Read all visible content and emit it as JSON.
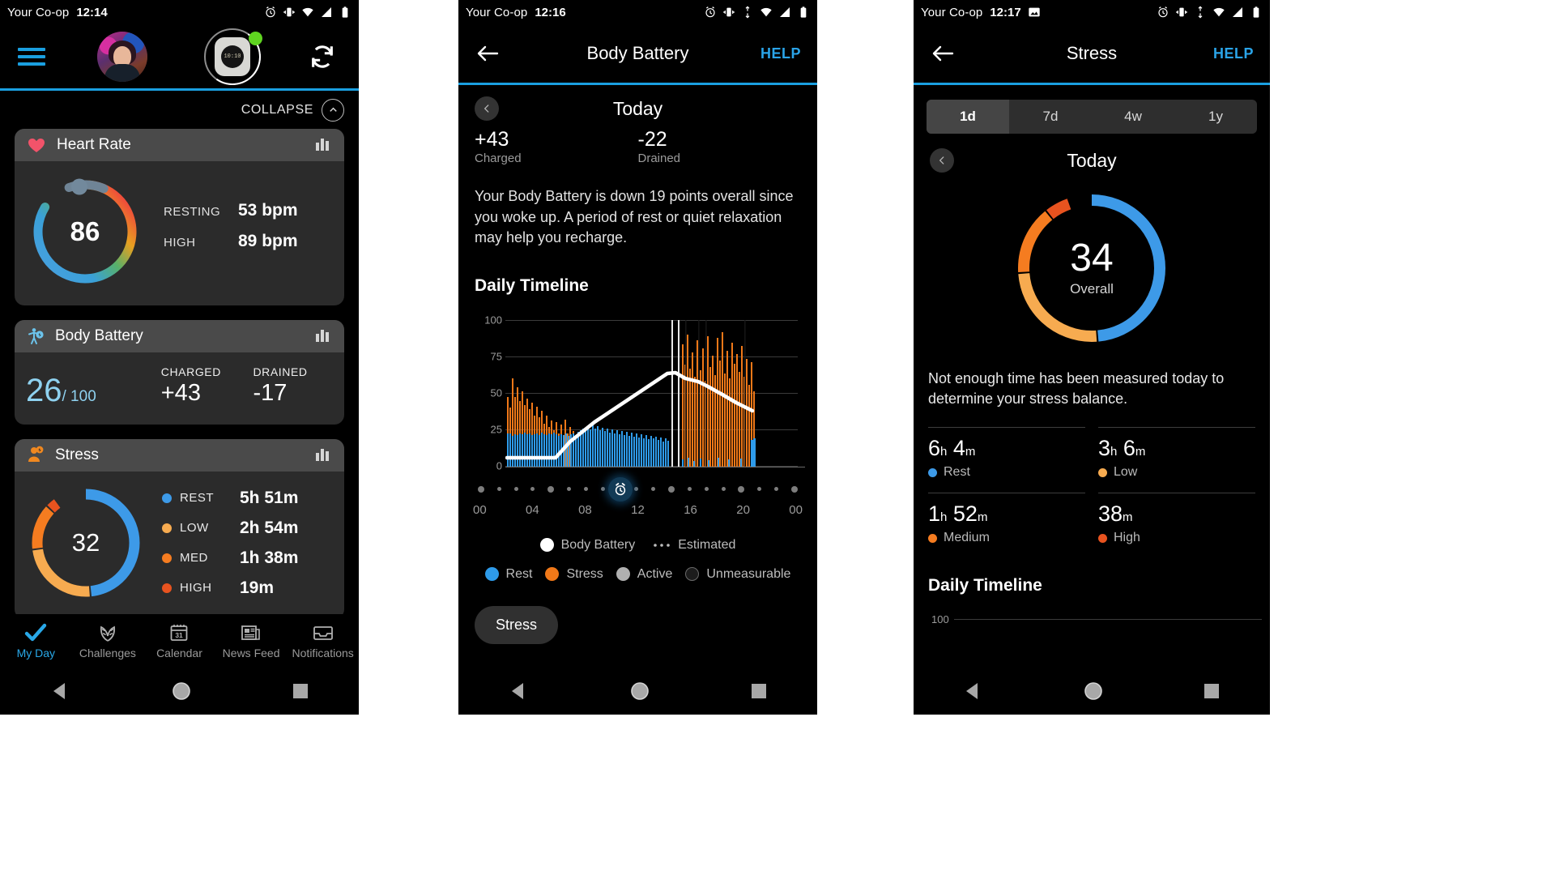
{
  "panel1": {
    "status": {
      "carrier": "Your Co-op",
      "time": "12:14",
      "icons": [
        "alarm-icon",
        "vibrate-icon",
        "wifi-icon",
        "signal-icon",
        "battery-icon"
      ]
    },
    "header": {
      "menu_icon": "hamburger-menu-icon",
      "avatar": "user-avatar",
      "device": "watch-device-icon",
      "device_time": "10:10",
      "sync_icon": "sync-refresh-icon",
      "status_dot_color": "#5fd420"
    },
    "collapse": {
      "label": "COLLAPSE",
      "icon": "chevron-up-icon"
    },
    "heart_rate": {
      "title": "Heart Rate",
      "icon": "heart-icon",
      "chart_icon": "bar-chart-icon",
      "current": "86",
      "rows": [
        {
          "label": "RESTING",
          "value": "53 bpm"
        },
        {
          "label": "HIGH",
          "value": "89 bpm"
        }
      ]
    },
    "body_battery": {
      "title": "Body Battery",
      "icon": "body-battery-icon",
      "chart_icon": "bar-chart-icon",
      "value": "26",
      "max": "/ 100",
      "charged_label": "CHARGED",
      "charged_value": "+43",
      "drained_label": "DRAINED",
      "drained_value": "-17"
    },
    "stress": {
      "title": "Stress",
      "icon": "stress-person-icon",
      "chart_icon": "bar-chart-icon",
      "score": "32",
      "legend": [
        {
          "label": "REST",
          "value": "5h 51m",
          "color": "#3d9ae8"
        },
        {
          "label": "LOW",
          "value": "2h 54m",
          "color": "#f7ab50"
        },
        {
          "label": "MED",
          "value": "1h 38m",
          "color": "#f57c20"
        },
        {
          "label": "HIGH",
          "value": "19m",
          "color": "#e8531f"
        }
      ]
    },
    "bottom_nav": [
      {
        "label": "My Day",
        "icon": "check-icon",
        "active": true
      },
      {
        "label": "Challenges",
        "icon": "laurel-wreath-icon",
        "active": false
      },
      {
        "label": "Calendar",
        "icon": "calendar-icon",
        "active": false
      },
      {
        "label": "News Feed",
        "icon": "newspaper-icon",
        "active": false
      },
      {
        "label": "Notifications",
        "icon": "inbox-icon",
        "active": false
      }
    ],
    "system_nav": [
      "back-triangle-icon",
      "home-circle-icon",
      "recents-square-icon"
    ]
  },
  "panel2": {
    "status": {
      "carrier": "Your Co-op",
      "time": "12:16"
    },
    "appbar": {
      "back_icon": "arrow-left-icon",
      "title": "Body Battery",
      "help": "HELP"
    },
    "daynav": {
      "prev_icon": "chevron-left-icon",
      "day": "Today"
    },
    "summary": {
      "charged_value": "+43",
      "charged_label": "Charged",
      "drained_value": "-22",
      "drained_label": "Drained"
    },
    "paragraph": "Your Body Battery is down 19 points overall since you woke up. A period of rest or quiet relaxation may help you recharge.",
    "section_title": "Daily Timeline",
    "chart_ylabels": [
      "100",
      "75",
      "50",
      "25",
      "0"
    ],
    "chart_xlabels": [
      "00",
      "04",
      "08",
      "12",
      "16",
      "20",
      "00"
    ],
    "alarm_icon": "alarm-clock-icon",
    "legend_top": [
      {
        "label": "Body Battery",
        "marker": "solid-white-dot",
        "color": "#ffffff"
      },
      {
        "label": "Estimated",
        "marker": "dotted-line",
        "color": "#bdbdbd"
      }
    ],
    "legend_bottom": [
      {
        "label": "Rest",
        "color": "#2e9bea"
      },
      {
        "label": "Stress",
        "color": "#f07818"
      },
      {
        "label": "Active",
        "color": "#b0b0b0"
      },
      {
        "label": "Unmeasurable",
        "color": "#2b2b2b"
      }
    ],
    "pill": "Stress"
  },
  "panel3": {
    "status": {
      "carrier": "Your Co-op",
      "time": "12:17"
    },
    "appbar": {
      "back_icon": "arrow-left-icon",
      "title": "Stress",
      "help": "HELP"
    },
    "range_tabs": [
      {
        "label": "1d",
        "active": true
      },
      {
        "label": "7d",
        "active": false
      },
      {
        "label": "4w",
        "active": false
      },
      {
        "label": "1y",
        "active": false
      }
    ],
    "daynav": {
      "prev_icon": "chevron-left-icon",
      "day": "Today"
    },
    "ring": {
      "score": "34",
      "sublabel": "Overall"
    },
    "message": "Not enough time has been measured today to determine your stress balance.",
    "stats": [
      {
        "hours": "6",
        "h": "h",
        "minutes": "4",
        "m": "m",
        "label": "Rest",
        "color": "#3d9ae8"
      },
      {
        "hours": "3",
        "h": "h",
        "minutes": "6",
        "m": "m",
        "label": "Low",
        "color": "#f7ab50"
      },
      {
        "hours": "1",
        "h": "h",
        "minutes": "52",
        "m": "m",
        "label": "Medium",
        "color": "#f57c20"
      },
      {
        "hours": "",
        "h": "",
        "minutes": "38",
        "m": "m",
        "label": "High",
        "color": "#e8531f"
      }
    ],
    "section_title": "Daily Timeline",
    "mini_axis": "100"
  },
  "chart_data": [
    {
      "type": "area",
      "title": "Daily Timeline",
      "panel": "Body Battery",
      "xlabel": "",
      "ylabel": "",
      "ylim": [
        0,
        100
      ],
      "yticks": [
        0,
        25,
        50,
        75,
        100
      ],
      "xticks": [
        "00",
        "04",
        "08",
        "12",
        "16",
        "20",
        "00"
      ],
      "grid": true,
      "legend": [
        "Body Battery",
        "Estimated",
        "Rest",
        "Stress",
        "Active",
        "Unmeasurable"
      ],
      "series": [
        {
          "name": "Body Battery",
          "x": [
            0,
            1,
            2,
            3,
            4,
            5,
            6,
            7,
            7.5,
            8,
            9,
            10,
            11,
            12
          ],
          "values": [
            7,
            7,
            7,
            7,
            14,
            22,
            31,
            40,
            48,
            47,
            41,
            36,
            31,
            26
          ]
        },
        {
          "name": "Stress (orange bars)",
          "x": [
            0,
            0.5,
            1,
            1.5,
            2,
            2.5,
            3,
            3.5,
            4,
            5,
            6,
            7,
            7.6,
            8,
            8.5,
            9,
            9.5,
            10,
            10.5,
            11,
            11.5,
            12
          ],
          "values": [
            30,
            48,
            40,
            35,
            32,
            25,
            5,
            0,
            0,
            0,
            0,
            0,
            75,
            70,
            72,
            78,
            68,
            80,
            70,
            74,
            66,
            40
          ]
        },
        {
          "name": "Rest (blue bars)",
          "x": [
            0,
            0.5,
            1,
            1.5,
            2,
            2.5,
            3,
            3.5,
            4,
            4.5,
            5,
            5.5,
            6,
            6.5,
            7,
            7.5,
            8,
            9,
            10,
            11,
            12
          ],
          "values": [
            22,
            20,
            20,
            21,
            22,
            24,
            23,
            24,
            23,
            22,
            21,
            22,
            23,
            22,
            22,
            20,
            8,
            6,
            5,
            5,
            25
          ]
        }
      ],
      "marker": {
        "label": "alarm",
        "x": 7.2
      }
    },
    {
      "type": "donut",
      "title": "Stress Today",
      "panel": "Stress",
      "center_value": 34,
      "center_label": "Overall",
      "slices": [
        {
          "name": "Rest",
          "value": 6.067,
          "label": "6 h 4 m",
          "color": "#3d9ae8"
        },
        {
          "name": "Low",
          "value": 3.1,
          "label": "3 h 6 m",
          "color": "#f7ab50"
        },
        {
          "name": "Medium",
          "value": 1.867,
          "label": "1 h 52 m",
          "color": "#f57c20"
        },
        {
          "name": "High",
          "value": 0.633,
          "label": "38 m",
          "color": "#e8531f"
        }
      ]
    },
    {
      "type": "donut",
      "title": "Stress (card)",
      "panel": "My Day",
      "center_value": 32,
      "slices": [
        {
          "name": "REST",
          "value": 5.85,
          "label": "5h 51m",
          "color": "#3d9ae8"
        },
        {
          "name": "LOW",
          "value": 2.9,
          "label": "2h 54m",
          "color": "#f7ab50"
        },
        {
          "name": "MED",
          "value": 1.63,
          "label": "1h 38m",
          "color": "#f57c20"
        },
        {
          "name": "HIGH",
          "value": 0.32,
          "label": "19m",
          "color": "#e8531f"
        }
      ]
    },
    {
      "type": "gauge",
      "title": "Heart Rate",
      "panel": "My Day",
      "center_value": 86,
      "range": [
        40,
        120
      ],
      "stats": [
        {
          "name": "RESTING",
          "value": 53,
          "unit": "bpm"
        },
        {
          "name": "HIGH",
          "value": 89,
          "unit": "bpm"
        }
      ]
    }
  ]
}
